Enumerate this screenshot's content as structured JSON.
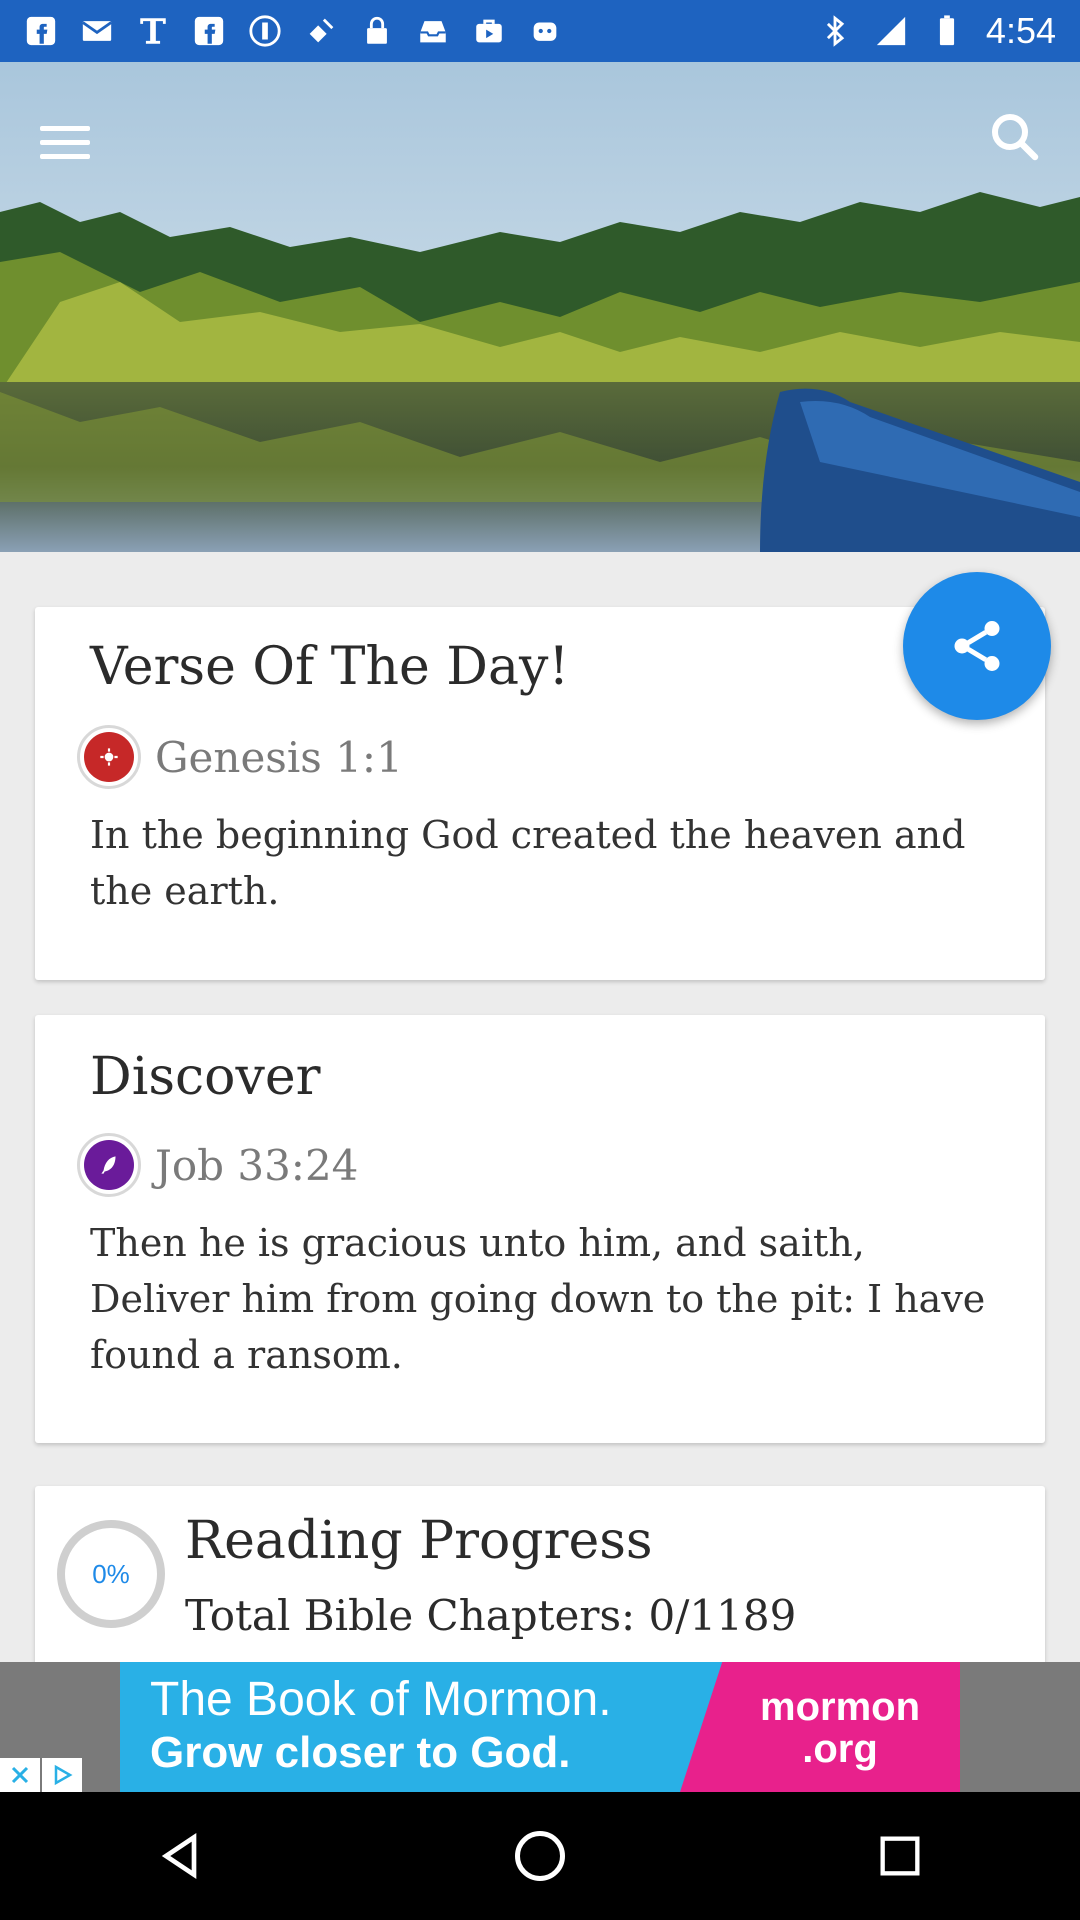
{
  "status_bar": {
    "time": "4:54",
    "icons": [
      "facebook-icon",
      "mail-icon",
      "text-icon",
      "facebook-icon",
      "app-icon",
      "fake-gps-icon",
      "lock-icon",
      "inbox-icon",
      "briefcase-icon",
      "bot-icon",
      "bluetooth-icon",
      "signal-icon",
      "battery-icon"
    ]
  },
  "header": {
    "menu_icon": "hamburger-menu-icon",
    "search_icon": "search-icon"
  },
  "verse_of_day": {
    "title": "Verse Of The Day!",
    "reference": "Genesis 1:1",
    "text": "In the beginning God created the heaven and the earth.",
    "badge_color": "#c62828"
  },
  "discover": {
    "title": "Discover",
    "reference": "Job 33:24",
    "text": "Then he is gracious unto him, and saith, Deliver him from going down to the pit: I have found a ransom.",
    "badge_color": "#6a1b9a"
  },
  "reading_progress": {
    "percent_label": "0%",
    "title": "Reading Progress",
    "subtitle": "Total Bible Chapters: 0/1189"
  },
  "share_button": {
    "icon": "share-icon",
    "color": "#1e8ae8"
  },
  "ad": {
    "line1": "The Book of Mormon.",
    "line2": "Grow closer to God.",
    "brand_line1": "mormon",
    "brand_line2": ".org"
  },
  "nav_bar": {
    "buttons": [
      "back-icon",
      "home-icon",
      "recents-icon"
    ]
  }
}
